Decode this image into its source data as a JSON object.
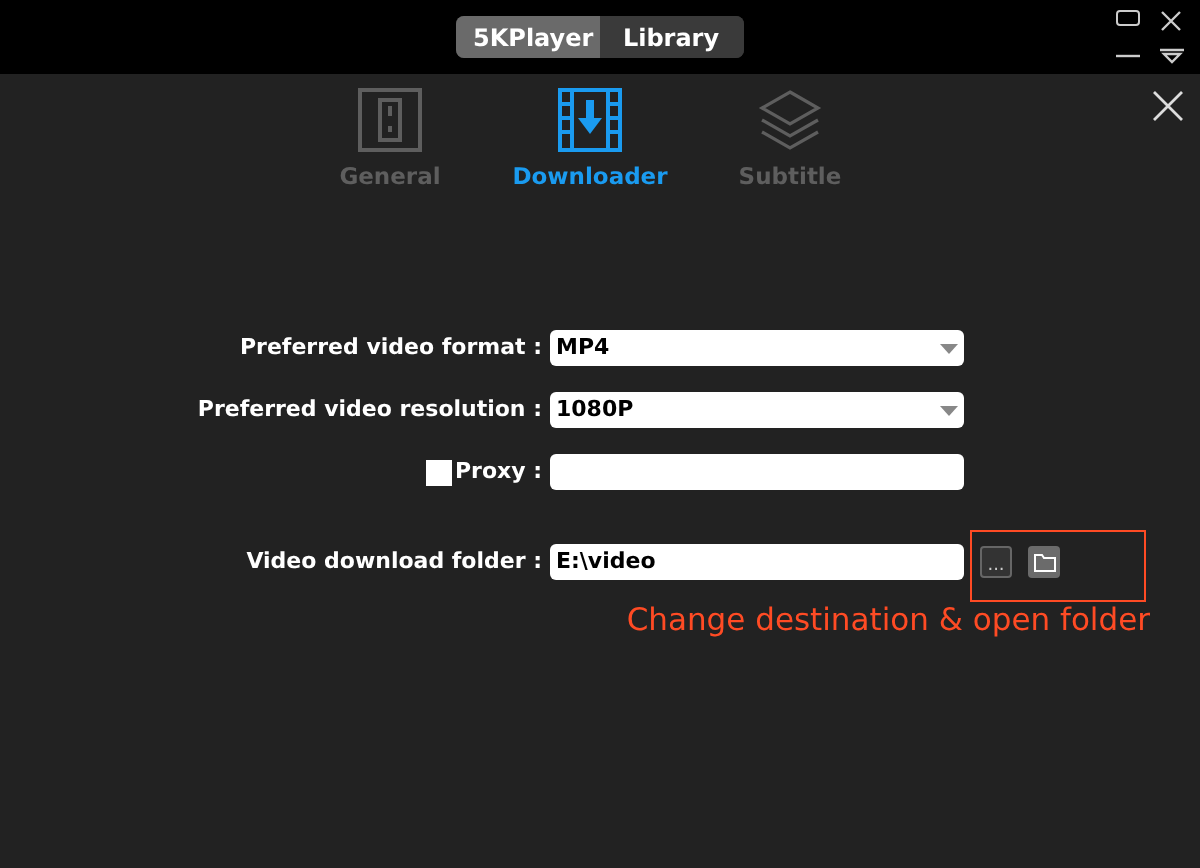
{
  "header_tabs": [
    {
      "label": "5KPlayer",
      "selected": true
    },
    {
      "label": "Library",
      "selected": false
    }
  ],
  "settings_tabs": [
    {
      "label": "General",
      "kind": "switch",
      "selected": false
    },
    {
      "label": "Downloader",
      "kind": "download",
      "selected": true
    },
    {
      "label": "Subtitle",
      "kind": "layers",
      "selected": false
    }
  ],
  "fields": [
    {
      "kind": "select",
      "label": "Preferred video format :",
      "value": "MP4"
    },
    {
      "kind": "select",
      "label": "Preferred video resolution :",
      "value": "1080P"
    },
    {
      "kind": "checkbox_input",
      "label": "Proxy :",
      "checked": false
    },
    {
      "kind": "folder",
      "label": "Video download folder :",
      "value": "E:\\video",
      "browse_button": "...",
      "highlighted": true
    }
  ],
  "annotation": "Change destination & open folder"
}
